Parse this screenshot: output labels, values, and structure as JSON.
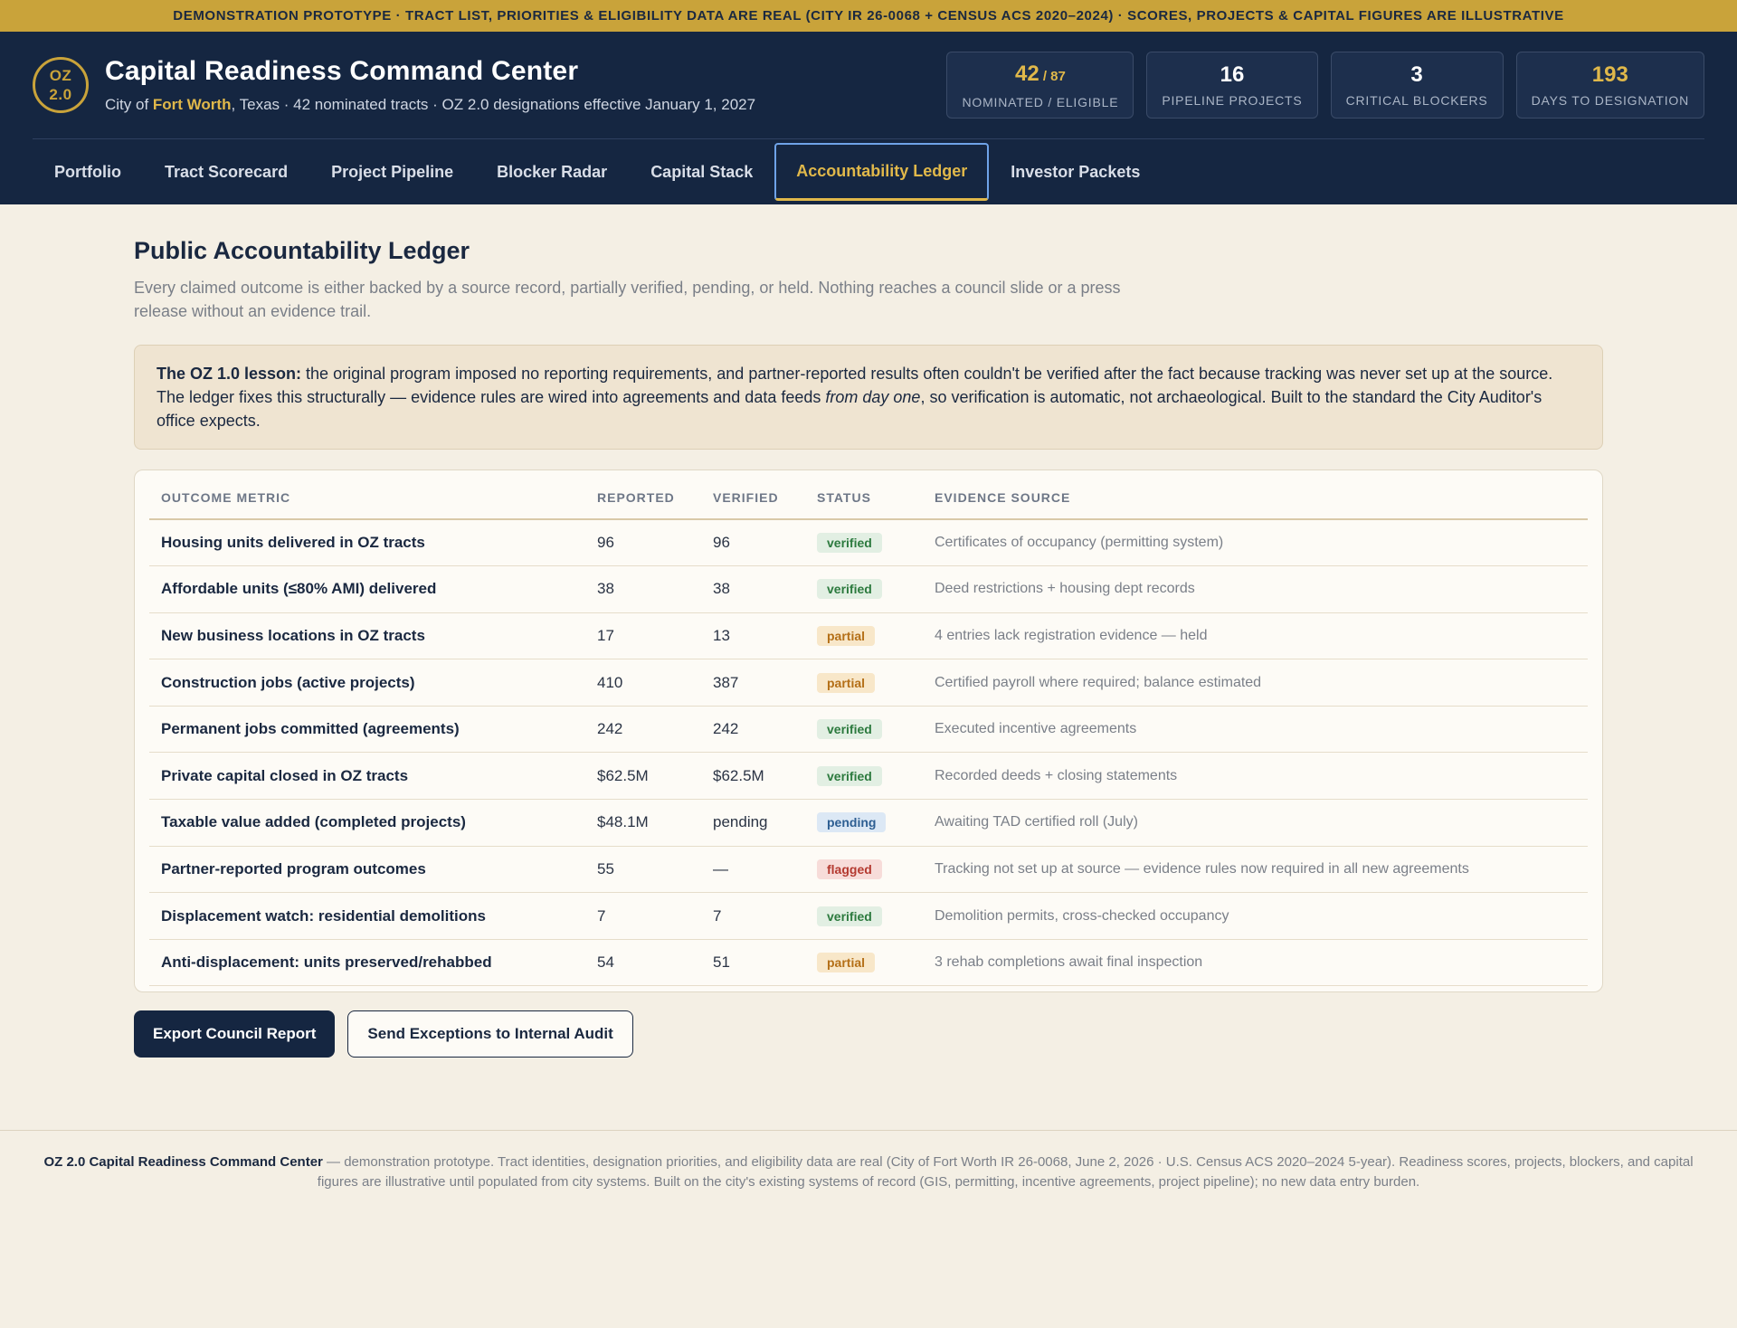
{
  "banner": "DEMONSTRATION PROTOTYPE · TRACT LIST, PRIORITIES & ELIGIBILITY DATA ARE REAL (CITY IR 26-0068 + CENSUS ACS 2020–2024) · SCORES, PROJECTS & CAPITAL FIGURES ARE ILLUSTRATIVE",
  "header": {
    "logo_line1": "OZ",
    "logo_line2": "2.0",
    "title": "Capital Readiness Command Center",
    "sub_prefix": "City of ",
    "sub_city": "Fort Worth",
    "sub_suffix": ", Texas · 42 nominated tracts · OZ 2.0 designations effective January 1, 2027",
    "stats": [
      {
        "value": "42",
        "suffix": " / 87",
        "label": "Nominated / Eligible"
      },
      {
        "value": "16",
        "label": "Pipeline Projects"
      },
      {
        "value": "3",
        "label": "Critical Blockers"
      },
      {
        "value": "193",
        "label": "Days to Designation"
      }
    ]
  },
  "tabs": [
    "Portfolio",
    "Tract Scorecard",
    "Project Pipeline",
    "Blocker Radar",
    "Capital Stack",
    "Accountability Ledger",
    "Investor Packets"
  ],
  "active_tab": "Accountability Ledger",
  "page": {
    "title": "Public Accountability Ledger",
    "description": "Every claimed outcome is either backed by a source record, partially verified, pending, or held. Nothing reaches a council slide or a press release without an evidence trail.",
    "lesson_lead": "The OZ 1.0 lesson:",
    "lesson_body1": " the original program imposed no reporting requirements, and partner-reported results often couldn't be verified after the fact because tracking was never set up at the source. The ledger fixes this structurally — evidence rules are wired into agreements and data feeds ",
    "lesson_italic": "from day one",
    "lesson_body2": ", so verification is automatic, not archaeological. Built to the standard the City Auditor's office expects."
  },
  "table": {
    "headers": [
      "Outcome Metric",
      "Reported",
      "Verified",
      "Status",
      "Evidence Source"
    ],
    "rows": [
      {
        "metric": "Housing units delivered in OZ tracts",
        "reported": "96",
        "verified": "96",
        "status": "verified",
        "source": "Certificates of occupancy (permitting system)"
      },
      {
        "metric": "Affordable units (≤80% AMI) delivered",
        "reported": "38",
        "verified": "38",
        "status": "verified",
        "source": "Deed restrictions + housing dept records"
      },
      {
        "metric": "New business locations in OZ tracts",
        "reported": "17",
        "verified": "13",
        "status": "partial",
        "source": "4 entries lack registration evidence — held"
      },
      {
        "metric": "Construction jobs (active projects)",
        "reported": "410",
        "verified": "387",
        "status": "partial",
        "source": "Certified payroll where required; balance estimated"
      },
      {
        "metric": "Permanent jobs committed (agreements)",
        "reported": "242",
        "verified": "242",
        "status": "verified",
        "source": "Executed incentive agreements"
      },
      {
        "metric": "Private capital closed in OZ tracts",
        "reported": "$62.5M",
        "verified": "$62.5M",
        "status": "verified",
        "source": "Recorded deeds + closing statements"
      },
      {
        "metric": "Taxable value added (completed projects)",
        "reported": "$48.1M",
        "verified": "pending",
        "status": "pending",
        "source": "Awaiting TAD certified roll (July)"
      },
      {
        "metric": "Partner-reported program outcomes",
        "reported": "55",
        "verified": "—",
        "status": "flagged",
        "source": "Tracking not set up at source — evidence rules now required in all new agreements"
      },
      {
        "metric": "Displacement watch: residential demolitions",
        "reported": "7",
        "verified": "7",
        "status": "verified",
        "source": "Demolition permits, cross-checked occupancy"
      },
      {
        "metric": "Anti-displacement: units preserved/rehabbed",
        "reported": "54",
        "verified": "51",
        "status": "partial",
        "source": "3 rehab completions await final inspection"
      }
    ]
  },
  "actions": {
    "export": "Export Council Report",
    "audit": "Send Exceptions to Internal Audit"
  },
  "footer": {
    "lead": "OZ 2.0 Capital Readiness Command Center",
    "body": " — demonstration prototype. Tract identities, designation priorities, and eligibility data are real (City of Fort Worth IR 26-0068, June 2, 2026 · U.S. Census ACS 2020–2024 5-year). Readiness scores, projects, blockers, and capital figures are illustrative until populated from city systems. Built on the city's existing systems of record (GIS, permitting, incentive agreements, project pipeline); no new data entry burden."
  },
  "colors": {
    "navy": "#152641",
    "gold": "#c9a33a",
    "cream": "#f4efe4"
  }
}
